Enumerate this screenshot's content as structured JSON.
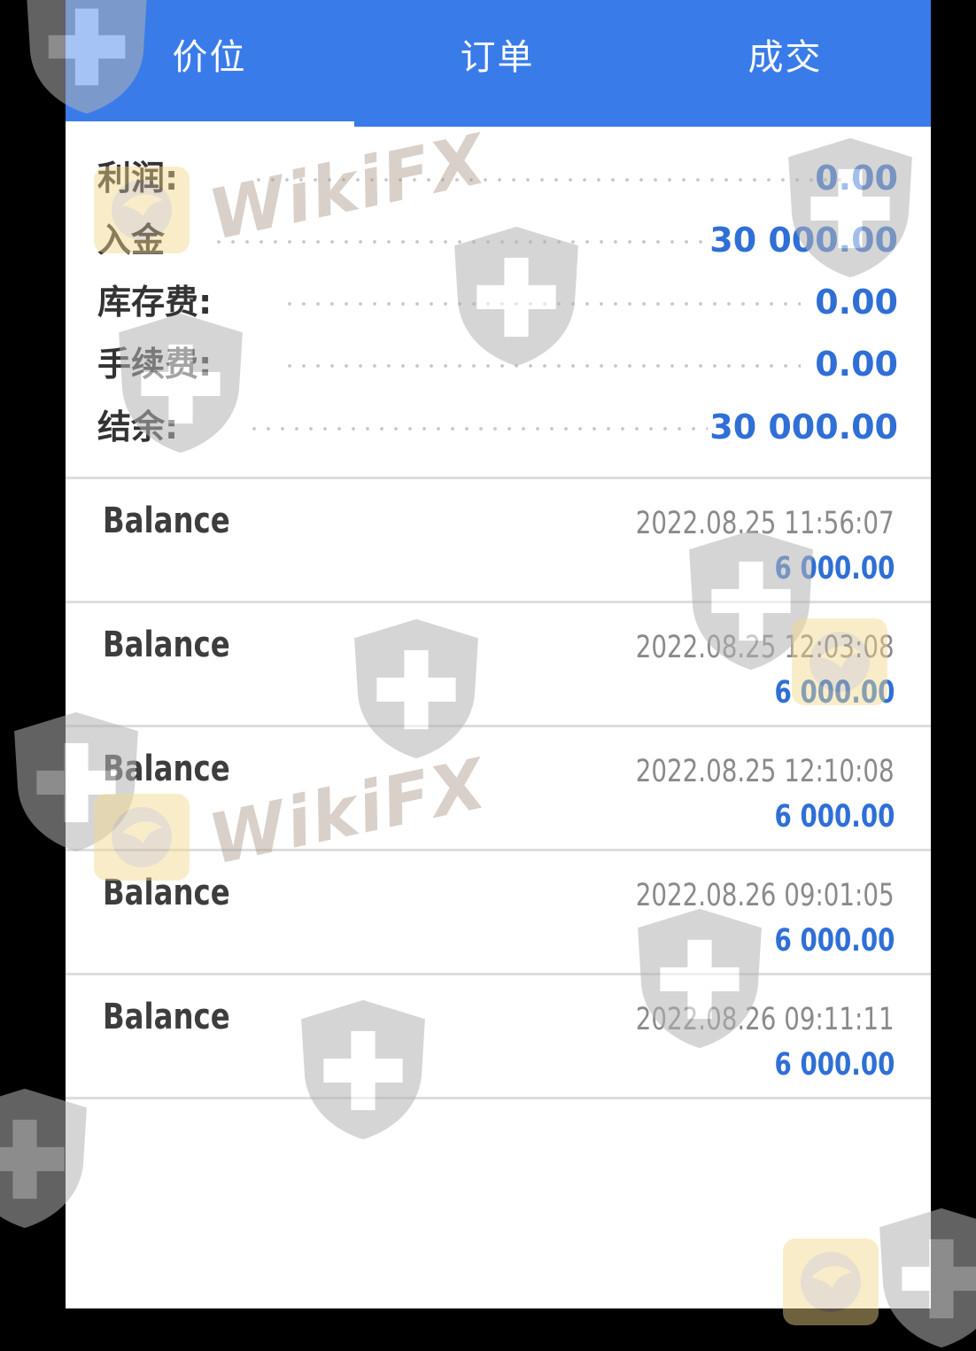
{
  "tabs": [
    {
      "label": "价位",
      "active": true
    },
    {
      "label": "订单",
      "active": false
    },
    {
      "label": "成交",
      "active": false
    }
  ],
  "summary": [
    {
      "label": "利润:",
      "value": "0.00"
    },
    {
      "label": "入金",
      "value": "30 000.00"
    },
    {
      "label": "库存费:",
      "value": "0.00"
    },
    {
      "label": "手续费:",
      "value": "0.00"
    },
    {
      "label": "结余:",
      "value": "30 000.00"
    }
  ],
  "deals": [
    {
      "type": "Balance",
      "time": "2022.08.25 11:56:07",
      "amount": "6 000.00"
    },
    {
      "type": "Balance",
      "time": "2022.08.25 12:03:08",
      "amount": "6 000.00"
    },
    {
      "type": "Balance",
      "time": "2022.08.25 12:10:08",
      "amount": "6 000.00"
    },
    {
      "type": "Balance",
      "time": "2022.08.26 09:01:05",
      "amount": "6 000.00"
    },
    {
      "type": "Balance",
      "time": "2022.08.26 09:11:11",
      "amount": "6 000.00"
    }
  ],
  "watermark": {
    "text": "WikiFX"
  },
  "colors": {
    "header": "#3a7bea",
    "value": "#2f6fd6",
    "label": "#333333"
  }
}
